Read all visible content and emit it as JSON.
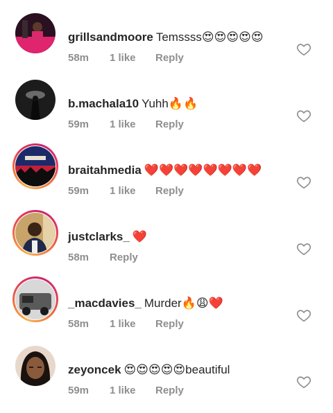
{
  "comments": [
    {
      "username": "grillsandmoore",
      "text": "Temssss😍😍😍😍😍",
      "time": "58m",
      "likes": "1 like",
      "reply": "Reply"
    },
    {
      "username": "b.machala10",
      "text": "Yuhh🔥🔥",
      "time": "59m",
      "likes": "1 like",
      "reply": "Reply"
    },
    {
      "username": "braitahmedia",
      "text": "❤️❤️❤️❤️❤️❤️❤️❤️",
      "time": "59m",
      "likes": "1 like",
      "reply": "Reply"
    },
    {
      "username": "justclarks_",
      "text": "❤️",
      "time": "58m",
      "likes": "",
      "reply": "Reply"
    },
    {
      "username": "_macdavies_",
      "text": "Murder🔥😩❤️",
      "time": "58m",
      "likes": "1 like",
      "reply": "Reply"
    },
    {
      "username": "zeyoncek",
      "text": "😍😍😍😍😍beautiful",
      "time": "59m",
      "likes": "1 like",
      "reply": "Reply"
    }
  ],
  "colors": {
    "text": "#262626",
    "meta": "#8e8e8e",
    "heart_outline": "#8e8e8e",
    "story_ring_start": "#f9b24e",
    "story_ring_end": "#c8266f"
  },
  "icons": {
    "like": "heart-outline-icon"
  }
}
